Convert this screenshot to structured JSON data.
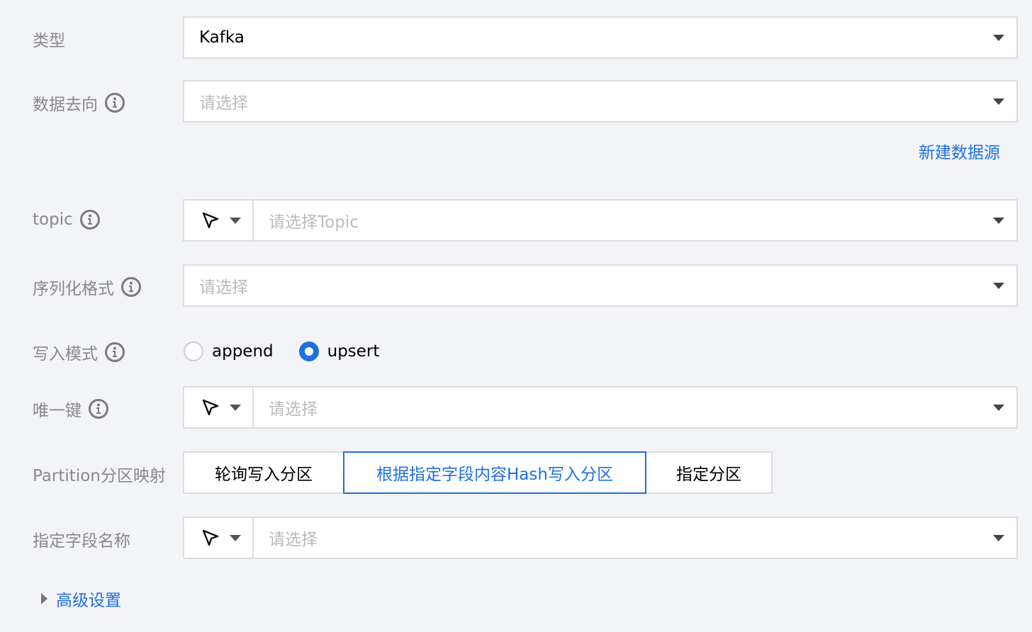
{
  "colors": {
    "accent": "#1f6fe0",
    "background": "#f3f4f7",
    "label": "#888888",
    "placeholder": "#bbbbbb"
  },
  "form": {
    "type": {
      "label": "类型",
      "value": "Kafka"
    },
    "data_target": {
      "label": "数据去向",
      "placeholder": "请选择",
      "link": "新建数据源"
    },
    "topic": {
      "label": "topic",
      "placeholder": "请选择Topic"
    },
    "serialization": {
      "label": "序列化格式",
      "placeholder": "请选择"
    },
    "write_mode": {
      "label": "写入模式",
      "options": [
        {
          "label": "append",
          "checked": false
        },
        {
          "label": "upsert",
          "checked": true
        }
      ]
    },
    "unique_key": {
      "label": "唯一键",
      "placeholder": "请选择"
    },
    "partition": {
      "label": "Partition分区映射",
      "options": [
        {
          "label": "轮询写入分区",
          "active": false
        },
        {
          "label": "根据指定字段内容Hash写入分区",
          "active": true
        },
        {
          "label": "指定分区",
          "active": false
        }
      ]
    },
    "field_name": {
      "label": "指定字段名称",
      "placeholder": "请选择"
    },
    "advanced": {
      "label": "高级设置"
    }
  },
  "icons": {
    "info": "info-icon",
    "caret": "caret-down-icon",
    "cursor": "cursor-pointer-icon",
    "expand": "caret-right-icon"
  }
}
